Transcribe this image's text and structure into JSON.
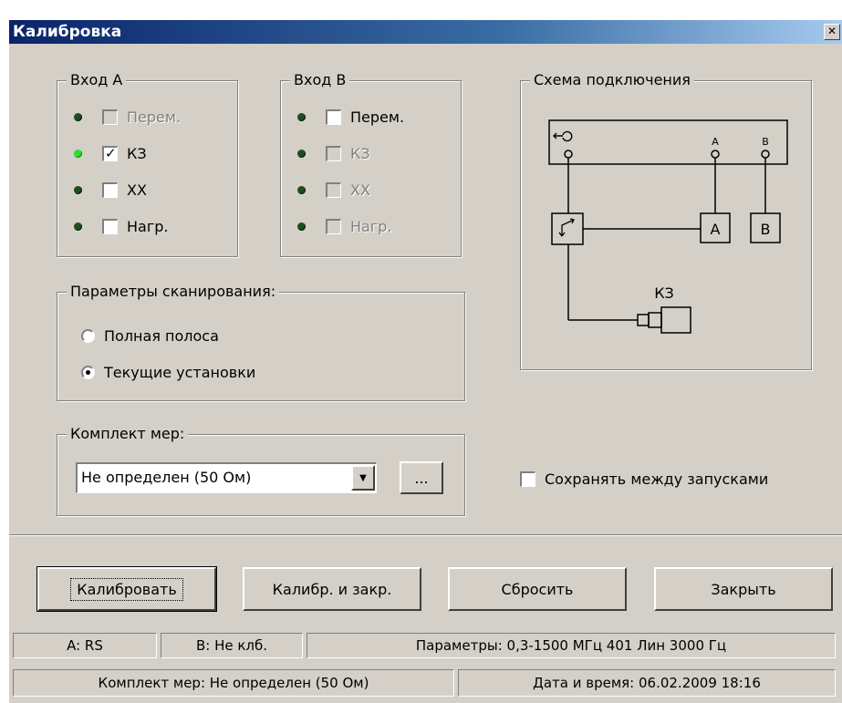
{
  "window": {
    "title": "Калибровка",
    "close_glyph": "✕"
  },
  "input_a": {
    "title": "Вход A",
    "items": [
      {
        "label": "Перем.",
        "checked": false,
        "enabled": false,
        "led_on": false
      },
      {
        "label": "КЗ",
        "checked": true,
        "enabled": true,
        "led_on": true
      },
      {
        "label": "ХХ",
        "checked": false,
        "enabled": true,
        "led_on": false
      },
      {
        "label": "Нагр.",
        "checked": false,
        "enabled": true,
        "led_on": false
      }
    ]
  },
  "input_b": {
    "title": "Вход B",
    "items": [
      {
        "label": "Перем.",
        "checked": false,
        "enabled": true,
        "led_on": false
      },
      {
        "label": "КЗ",
        "checked": false,
        "enabled": false,
        "led_on": false
      },
      {
        "label": "ХХ",
        "checked": false,
        "enabled": false,
        "led_on": false
      },
      {
        "label": "Нагр.",
        "checked": false,
        "enabled": false,
        "led_on": false
      }
    ]
  },
  "scan_params": {
    "title": "Параметры сканирования:",
    "options": [
      {
        "label": "Полная полоса",
        "selected": false
      },
      {
        "label": "Текущие установки",
        "selected": true
      }
    ]
  },
  "kit": {
    "title": "Комплект мер:",
    "selected": "Не определен (50 Ом)",
    "browse_label": "..."
  },
  "scheme": {
    "title": "Схема подключения",
    "port_a": "A",
    "port_b": "B",
    "box_a": "A",
    "box_b": "B",
    "load_label": "КЗ"
  },
  "save_between_runs": {
    "label": "Сохранять между запусками",
    "checked": false
  },
  "buttons": {
    "calibrate": "Калибровать",
    "calibrate_close": "Калибр. и закр.",
    "reset": "Сбросить",
    "close": "Закрыть"
  },
  "status": {
    "a": "A:  RS",
    "b": "B:  Не клб.",
    "params": "Параметры:  0,3-1500 МГц  401  Лин  3000 Гц",
    "kit": "Комплект мер:  Не определен (50 Ом)",
    "datetime": "Дата и время:  06.02.2009  18:16"
  },
  "colors": {
    "face": "#d4d0c8",
    "led_on": "#37d637",
    "led_off": "#1f4d1f",
    "title_bar": "#0a246a"
  }
}
